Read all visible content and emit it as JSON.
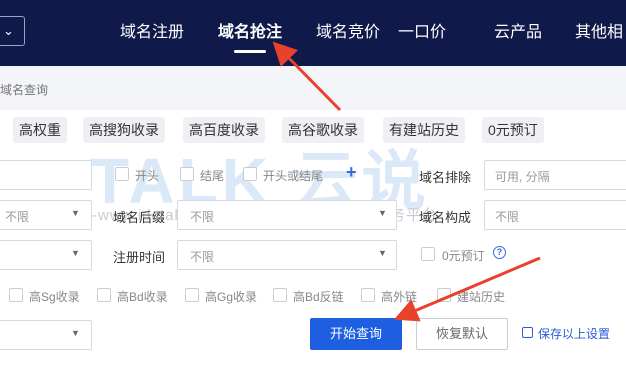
{
  "header": {
    "nav": [
      {
        "label": "域名注册",
        "active": false
      },
      {
        "label": "域名抢注",
        "active": true
      },
      {
        "label": "域名竞价",
        "active": false
      },
      {
        "label": "一口价",
        "active": false
      },
      {
        "label": "云产品",
        "active": false
      },
      {
        "label": "其他相",
        "active": false
      }
    ]
  },
  "breadcrumb": "域名查询",
  "quick_filters": [
    "高权重",
    "高搜狗收录",
    "高百度收录",
    "高谷歌收录",
    "有建站历史",
    "0元预订"
  ],
  "row1": {
    "opt_start": "开头",
    "opt_end": "结尾",
    "opt_start_or_end": "开头或结尾",
    "exclude_label": "域名排除",
    "exclude_placeholder": "可用, 分隔"
  },
  "row2": {
    "left_select": "不限",
    "suffix_label": "域名后缀",
    "suffix_value": "不限",
    "composition_label": "域名构成",
    "composition_value": "不限"
  },
  "row3": {
    "reg_time_label": "注册时间",
    "reg_time_value": "不限",
    "zero_reserve_label": "0元预订"
  },
  "row4": [
    "高Sg收录",
    "高Bd收录",
    "高Gg收录",
    "高Bd反链",
    "高外链",
    "建站历史"
  ],
  "actions": {
    "search": "开始查询",
    "reset": "恢复默认",
    "save": "保存以上设置"
  },
  "watermark": {
    "logo": "TALK 云说",
    "tagline": "-www.idctalk.com-国内专业云计算交流服务平台-"
  },
  "colors": {
    "header_bg": "#0f1a4a",
    "primary": "#1d5fe0",
    "annotation_arrow": "#e8412c"
  }
}
